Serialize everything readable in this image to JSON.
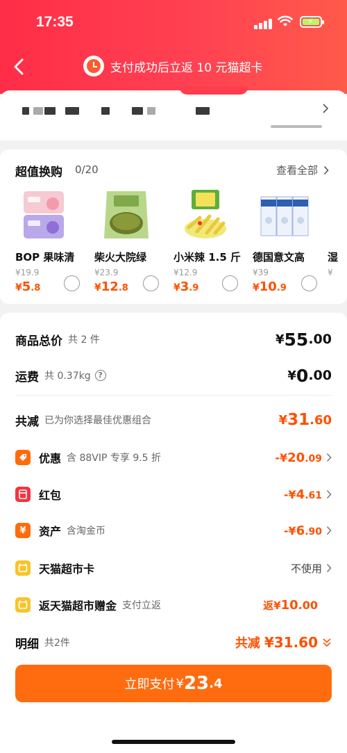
{
  "status_bar": {
    "time": "17:35"
  },
  "header": {
    "banner_text": "支付成功后立返 10 元猫超卡"
  },
  "deals": {
    "title": "超值换购",
    "count": "0/20",
    "view_all": "查看全部",
    "items": [
      {
        "name": "BOP 果味清",
        "original_price": "¥19.9",
        "price_symbol": "¥",
        "price_int": "5",
        "price_dec": ".8"
      },
      {
        "name": "柴火大院绿",
        "original_price": "¥23.9",
        "price_symbol": "¥",
        "price_int": "12",
        "price_dec": ".8"
      },
      {
        "name": "小米辣 1.5 斤",
        "original_price": "¥12.9",
        "price_symbol": "¥",
        "price_int": "3",
        "price_dec": ".9"
      },
      {
        "name": "德国意文高",
        "original_price": "¥39",
        "price_symbol": "¥",
        "price_int": "10",
        "price_dec": ".9"
      },
      {
        "name": "湿",
        "original_price": "¥",
        "price_symbol": "",
        "price_int": "",
        "price_dec": ""
      }
    ]
  },
  "summary": {
    "goods_total": {
      "label": "商品总价",
      "sub": "共 2 件",
      "symbol": "¥",
      "int": "55",
      "dec": ".00"
    },
    "shipping": {
      "label": "运费",
      "sub": "共 0.37kg",
      "help": "?",
      "symbol": "¥",
      "int": "0",
      "dec": ".00"
    },
    "total_discount": {
      "label": "共减",
      "sub": "已为你选择最佳优惠组合",
      "symbol": "¥",
      "int": "31",
      "dec": ".60"
    },
    "discount_rows": [
      {
        "label": "优惠",
        "sub": "含 88VIP 专享 9.5 折",
        "prefix": "-¥",
        "int": "20",
        "dec": ".09"
      },
      {
        "label": "红包",
        "sub": "",
        "prefix": "-¥",
        "int": "4",
        "dec": ".61"
      },
      {
        "label": "资产",
        "sub": "含淘金币",
        "prefix": "-¥",
        "int": "6",
        "dec": ".90"
      }
    ],
    "tmall_card": {
      "label": "天猫超市卡",
      "value": "不使用"
    },
    "return_bonus": {
      "label": "返天猫超市赠金",
      "sub": "支付立返",
      "prefix": "返¥",
      "int": "10",
      "dec": ".00"
    },
    "detail": {
      "label": "明细",
      "sub": "共2件",
      "value_label": "共减",
      "symbol": "¥",
      "value": "31.60"
    }
  },
  "pay_button": {
    "label": "立即支付",
    "symbol": "¥",
    "int": "23",
    "dec": ".4"
  },
  "colors": {
    "header_red": "#ff2d47",
    "accent_orange": "#ff5000",
    "pay_orange": "#ff6c10"
  }
}
